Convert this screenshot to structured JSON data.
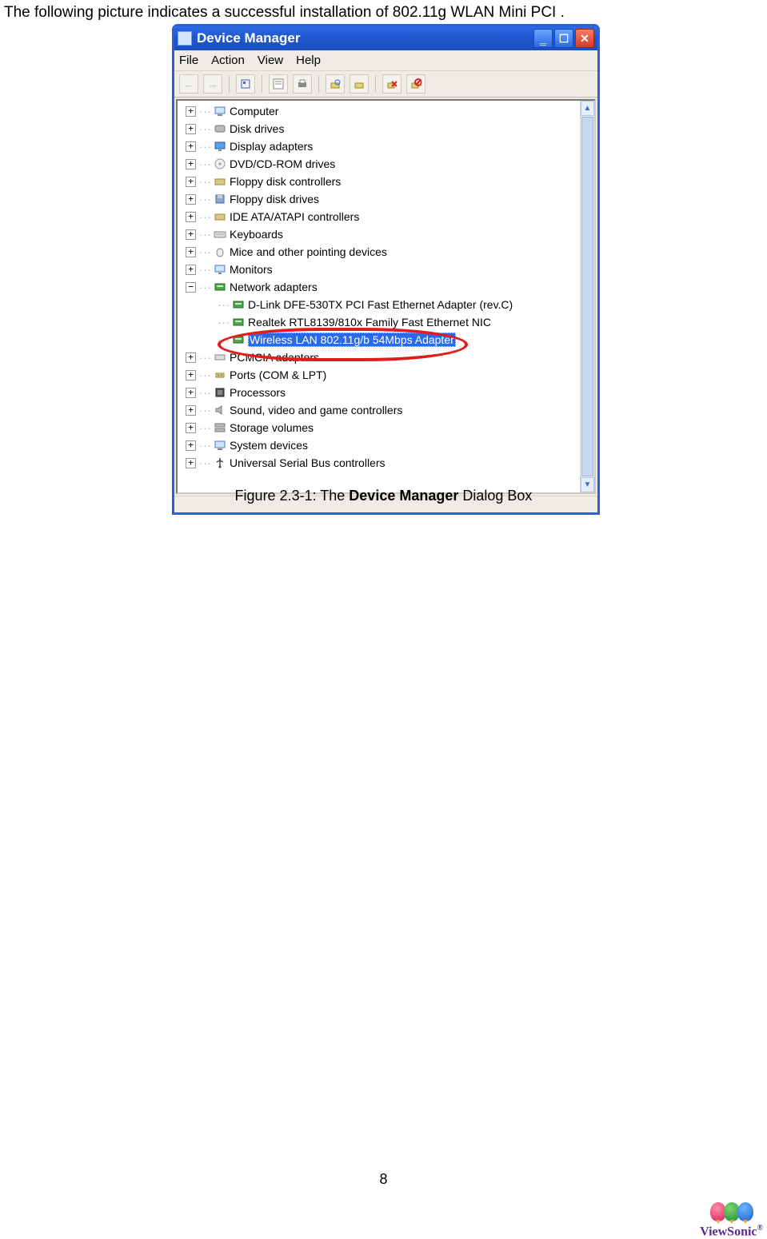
{
  "intro_text": "The following picture indicates a successful installation of 802.11g WLAN Mini PCI .",
  "window": {
    "title": "Device Manager",
    "menu": [
      "File",
      "Action",
      "View",
      "Help"
    ],
    "toolbar_icons": [
      "back-icon",
      "forward-icon",
      "up-tree-icon",
      "properties-icon",
      "print-icon",
      "refresh-icon",
      "scan-icon",
      "uninstall-icon",
      "disable-icon"
    ],
    "tree": [
      {
        "expander": "+",
        "icon": "computer-icon",
        "label": "Computer"
      },
      {
        "expander": "+",
        "icon": "disk-icon",
        "label": "Disk drives"
      },
      {
        "expander": "+",
        "icon": "display-icon",
        "label": "Display adapters"
      },
      {
        "expander": "+",
        "icon": "dvd-icon",
        "label": "DVD/CD-ROM drives"
      },
      {
        "expander": "+",
        "icon": "floppy-ctrl-icon",
        "label": "Floppy disk controllers"
      },
      {
        "expander": "+",
        "icon": "floppy-icon",
        "label": "Floppy disk drives"
      },
      {
        "expander": "+",
        "icon": "ide-icon",
        "label": "IDE ATA/ATAPI controllers"
      },
      {
        "expander": "+",
        "icon": "keyboard-icon",
        "label": "Keyboards"
      },
      {
        "expander": "+",
        "icon": "mouse-icon",
        "label": "Mice and other pointing devices"
      },
      {
        "expander": "+",
        "icon": "monitor-icon",
        "label": "Monitors"
      },
      {
        "expander": "−",
        "icon": "network-icon",
        "label": "Network adapters",
        "children": [
          {
            "icon": "nic-icon",
            "label": "D-Link DFE-530TX PCI Fast Ethernet Adapter (rev.C)"
          },
          {
            "icon": "nic-icon",
            "label": "Realtek RTL8139/810x Family Fast Ethernet NIC"
          },
          {
            "icon": "nic-icon",
            "label": "Wireless LAN 802.11g/b 54Mbps Adapter",
            "selected": true
          }
        ]
      },
      {
        "expander": "+",
        "icon": "pcmcia-icon",
        "label": "PCMCIA adapters"
      },
      {
        "expander": "+",
        "icon": "ports-icon",
        "label": "Ports (COM & LPT)"
      },
      {
        "expander": "+",
        "icon": "cpu-icon",
        "label": "Processors"
      },
      {
        "expander": "+",
        "icon": "sound-icon",
        "label": "Sound, video and game controllers"
      },
      {
        "expander": "+",
        "icon": "storage-icon",
        "label": "Storage volumes"
      },
      {
        "expander": "+",
        "icon": "system-icon",
        "label": "System devices"
      },
      {
        "expander": "+",
        "icon": "usb-icon",
        "label": "Universal Serial Bus controllers"
      }
    ]
  },
  "caption": {
    "prefix": "Figure 2.3-1: The ",
    "bold": "Device Manager",
    "suffix": " Dialog Box"
  },
  "page_number": "8",
  "logo_text": "ViewSonic"
}
